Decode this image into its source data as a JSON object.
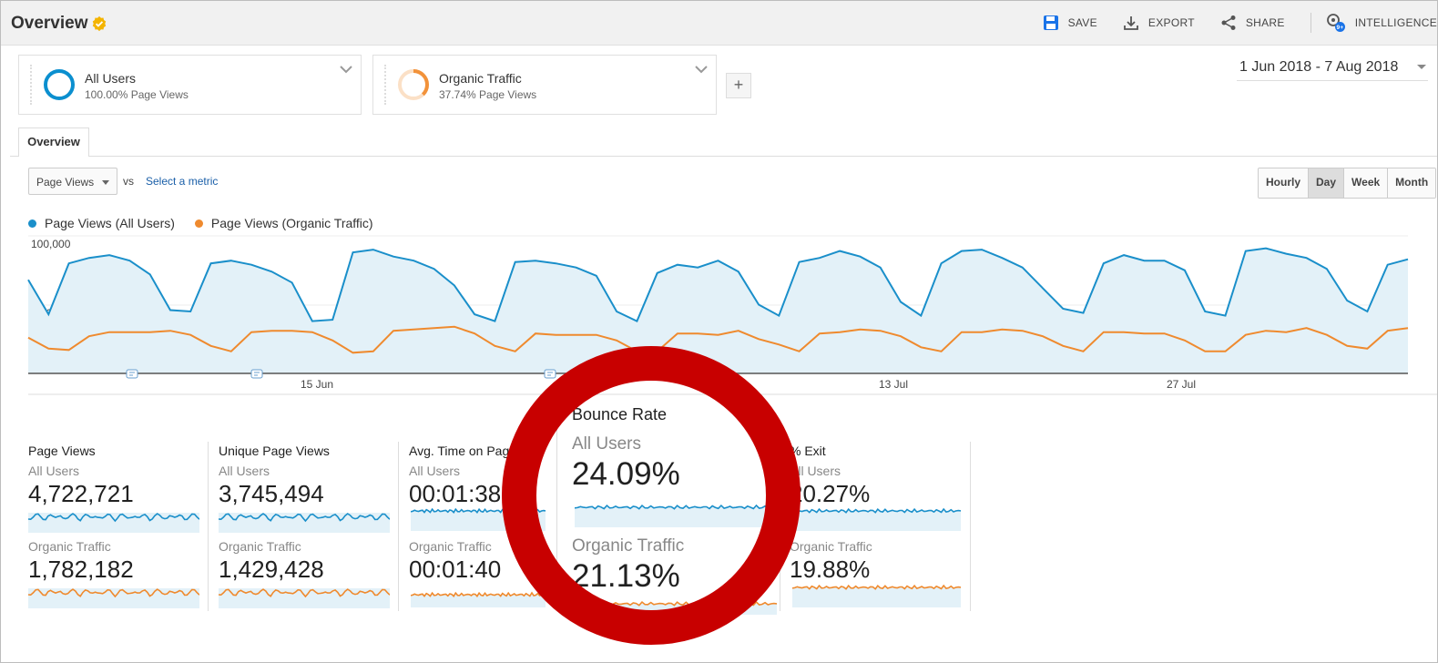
{
  "header": {
    "title": "Overview",
    "actions": {
      "save": "SAVE",
      "export": "EXPORT",
      "share": "SHARE",
      "intelligence": "INTELLIGENCE",
      "intelligence_badge": "9+"
    }
  },
  "segments": [
    {
      "name": "All Users",
      "sub": "100.00% Page Views",
      "color": "#0b8fcf"
    },
    {
      "name": "Organic Traffic",
      "sub": "37.74% Page Views",
      "color": "#f2923a"
    }
  ],
  "date_range": "1 Jun 2018 - 7 Aug 2018",
  "tabs": [
    "Overview"
  ],
  "metric_selector": {
    "value": "Page Views",
    "vs": "vs",
    "select_metric": "Select a metric"
  },
  "granularity": {
    "options": [
      "Hourly",
      "Day",
      "Week",
      "Month"
    ],
    "active": "Day"
  },
  "colors": {
    "all_users": "#1a8fca",
    "organic": "#ef8a2e",
    "area": "#e3f1f8",
    "callout": "#c80000"
  },
  "chart_data": {
    "type": "line",
    "title": "",
    "xlabel": "",
    "ylabel": "",
    "ylim": [
      0,
      100000
    ],
    "y_ticks": [
      "100,000",
      "50,000"
    ],
    "x_tick_labels": [
      "15 Jun",
      "13 Jul",
      "27 Jul"
    ],
    "x_start": "2018-06-01",
    "x_end": "2018-08-07",
    "series": [
      {
        "name": "Page Views (All Users)",
        "area": true,
        "values": [
          68000,
          43000,
          80000,
          84000,
          86000,
          82000,
          72000,
          46000,
          45000,
          80000,
          82000,
          79000,
          74000,
          66000,
          38000,
          39000,
          88000,
          90000,
          85000,
          82000,
          76000,
          64000,
          43000,
          38000,
          81000,
          82000,
          80000,
          77000,
          71000,
          45000,
          38000,
          73000,
          79000,
          77000,
          82000,
          74000,
          50000,
          42000,
          81000,
          84000,
          89000,
          85000,
          77000,
          52000,
          42000,
          80000,
          89000,
          90000,
          84000,
          77000,
          62000,
          47000,
          44000,
          80000,
          86000,
          82000,
          82000,
          75000,
          45000,
          42000,
          89000,
          91000,
          87000,
          84000,
          76000,
          53000,
          45000,
          79000,
          83000
        ]
      },
      {
        "name": "Page Views (Organic Traffic)",
        "area": false,
        "values": [
          26000,
          18000,
          17000,
          27000,
          30000,
          30000,
          30000,
          31000,
          28000,
          20000,
          16000,
          30000,
          31000,
          31000,
          30000,
          24000,
          15000,
          16000,
          31000,
          32000,
          33000,
          34000,
          29000,
          20000,
          16000,
          29000,
          28000,
          28000,
          28000,
          24000,
          16000,
          16000,
          29000,
          29000,
          28000,
          31000,
          25000,
          21000,
          16000,
          29000,
          30000,
          32000,
          31000,
          27000,
          19000,
          16000,
          30000,
          30000,
          32000,
          31000,
          27000,
          20000,
          16000,
          30000,
          30000,
          29000,
          29000,
          24000,
          16000,
          16000,
          28000,
          31000,
          30000,
          33000,
          28000,
          20000,
          18000,
          31000,
          33000
        ]
      }
    ]
  },
  "scorecards": [
    {
      "title": "Page Views",
      "all_label": "All Users",
      "all_value": "4,722,721",
      "org_label": "Organic Traffic",
      "org_value": "1,782,182"
    },
    {
      "title": "Unique Page Views",
      "all_label": "All Users",
      "all_value": "3,745,494",
      "org_label": "Organic Traffic",
      "org_value": "1,429,428"
    },
    {
      "title": "Avg. Time on Page",
      "all_label": "All Users",
      "all_value": "00:01:38",
      "org_label": "Organic Traffic",
      "org_value": "00:01:40"
    },
    {
      "title": "Bounce Rate",
      "all_label": "All Users",
      "all_value": "24.09%",
      "org_label": "Organic Traffic",
      "org_value": "21.13%"
    },
    {
      "title": "% Exit",
      "all_label": "All Users",
      "all_value": "20.27%",
      "org_label": "Organic Traffic",
      "org_value": "19.88%"
    }
  ]
}
